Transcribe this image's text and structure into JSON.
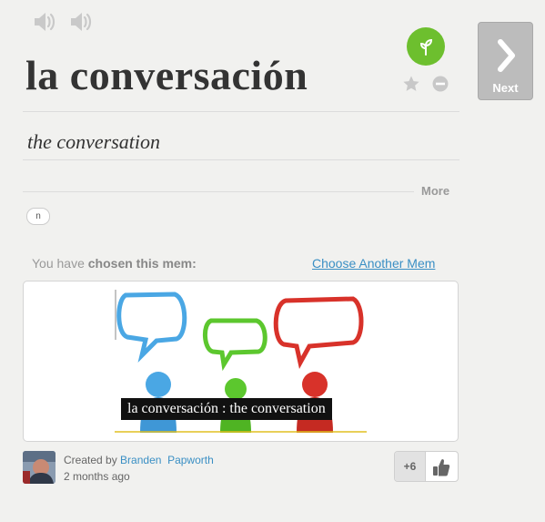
{
  "word": "la conversación",
  "translation": "the conversation",
  "more_label": "More",
  "part_of_speech": "n",
  "next_label": "Next",
  "chosen_prefix": "You have",
  "chosen_bold": "chosen this mem:",
  "choose_another": "Choose Another Mem",
  "mem_caption": "la conversación : the conversation",
  "created_by_label": "Created by",
  "author": "Branden  Papworth",
  "created_ago": "2 months ago",
  "vote_count": "+6",
  "colors": {
    "level_badge": "#6dbf2e",
    "link": "#3a8fc4",
    "bubble_blue": "#4aa7e4",
    "bubble_green": "#5cc72e",
    "bubble_red": "#d8322a"
  },
  "icons": [
    "speaker-icon",
    "speaker-slow-icon",
    "sprout-icon",
    "star-icon",
    "minus-circle-icon",
    "chevron-right-icon",
    "thumbs-up-icon"
  ]
}
